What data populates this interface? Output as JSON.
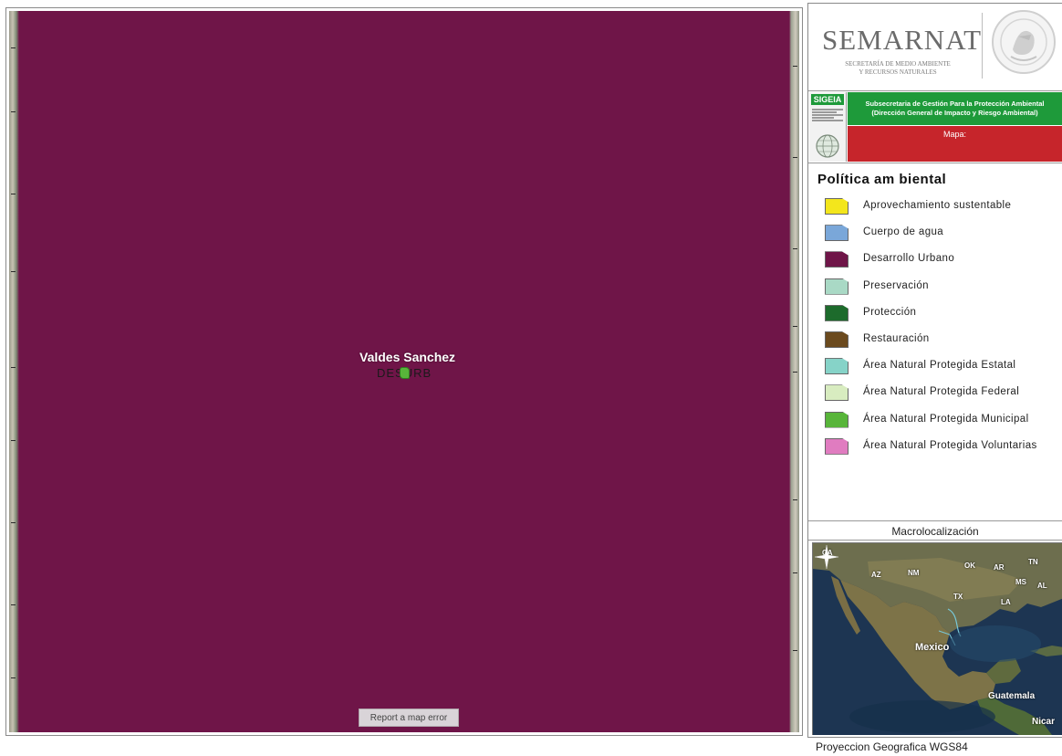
{
  "map": {
    "place_label": "Valdes Sanchez",
    "zone_code": "DESURB",
    "report_error": "Report a map error",
    "fill_color": "#6f1548"
  },
  "header": {
    "agency": "SEMARNAT",
    "agency_subtitle_1": "SECRETARÍA DE MEDIO AMBIENTE",
    "agency_subtitle_2": "Y RECURSOS NATURALES",
    "system": "SIGEIA",
    "subsecretaria_1": "Subsecretaria de Gestión Para la Protección Ambiental",
    "subsecretaria_2": "(Dirección General de Impacto y Riesgo Ambiental)",
    "mapa_label": "Mapa:"
  },
  "legend": {
    "title": "Política am biental",
    "items": [
      {
        "label": "Aprovechamiento sustentable",
        "color": "#f3e61c"
      },
      {
        "label": "Cuerpo de agua",
        "color": "#7aa7d9"
      },
      {
        "label": "Desarrollo Urbano",
        "color": "#6f1548"
      },
      {
        "label": "Preservación",
        "color": "#a9d9c5"
      },
      {
        "label": "Protección",
        "color": "#1d6b2c"
      },
      {
        "label": "Restauración",
        "color": "#6b4a1e"
      },
      {
        "label": "Área Natural Protegida Estatal",
        "color": "#86d3c8"
      },
      {
        "label": "Área Natural Protegida Federal",
        "color": "#d8ecc0"
      },
      {
        "label": "Área Natural Protegida Municipal",
        "color": "#58b53a"
      },
      {
        "label": "Área Natural Protegida Voluntarias",
        "color": "#e07cc0"
      }
    ]
  },
  "macro": {
    "title": "Macrolocalización",
    "labels": {
      "ca": "CA",
      "az": "AZ",
      "nm": "NM",
      "ok": "OK",
      "ar": "AR",
      "tn": "TN",
      "tx": "TX",
      "ms": "MS",
      "al": "AL",
      "la": "LA",
      "mexico": "Mexico",
      "guatemala": "Guatemala",
      "nicar": "Nicar"
    }
  },
  "footer": {
    "projection": "Proyeccion Geografica WGS84"
  }
}
